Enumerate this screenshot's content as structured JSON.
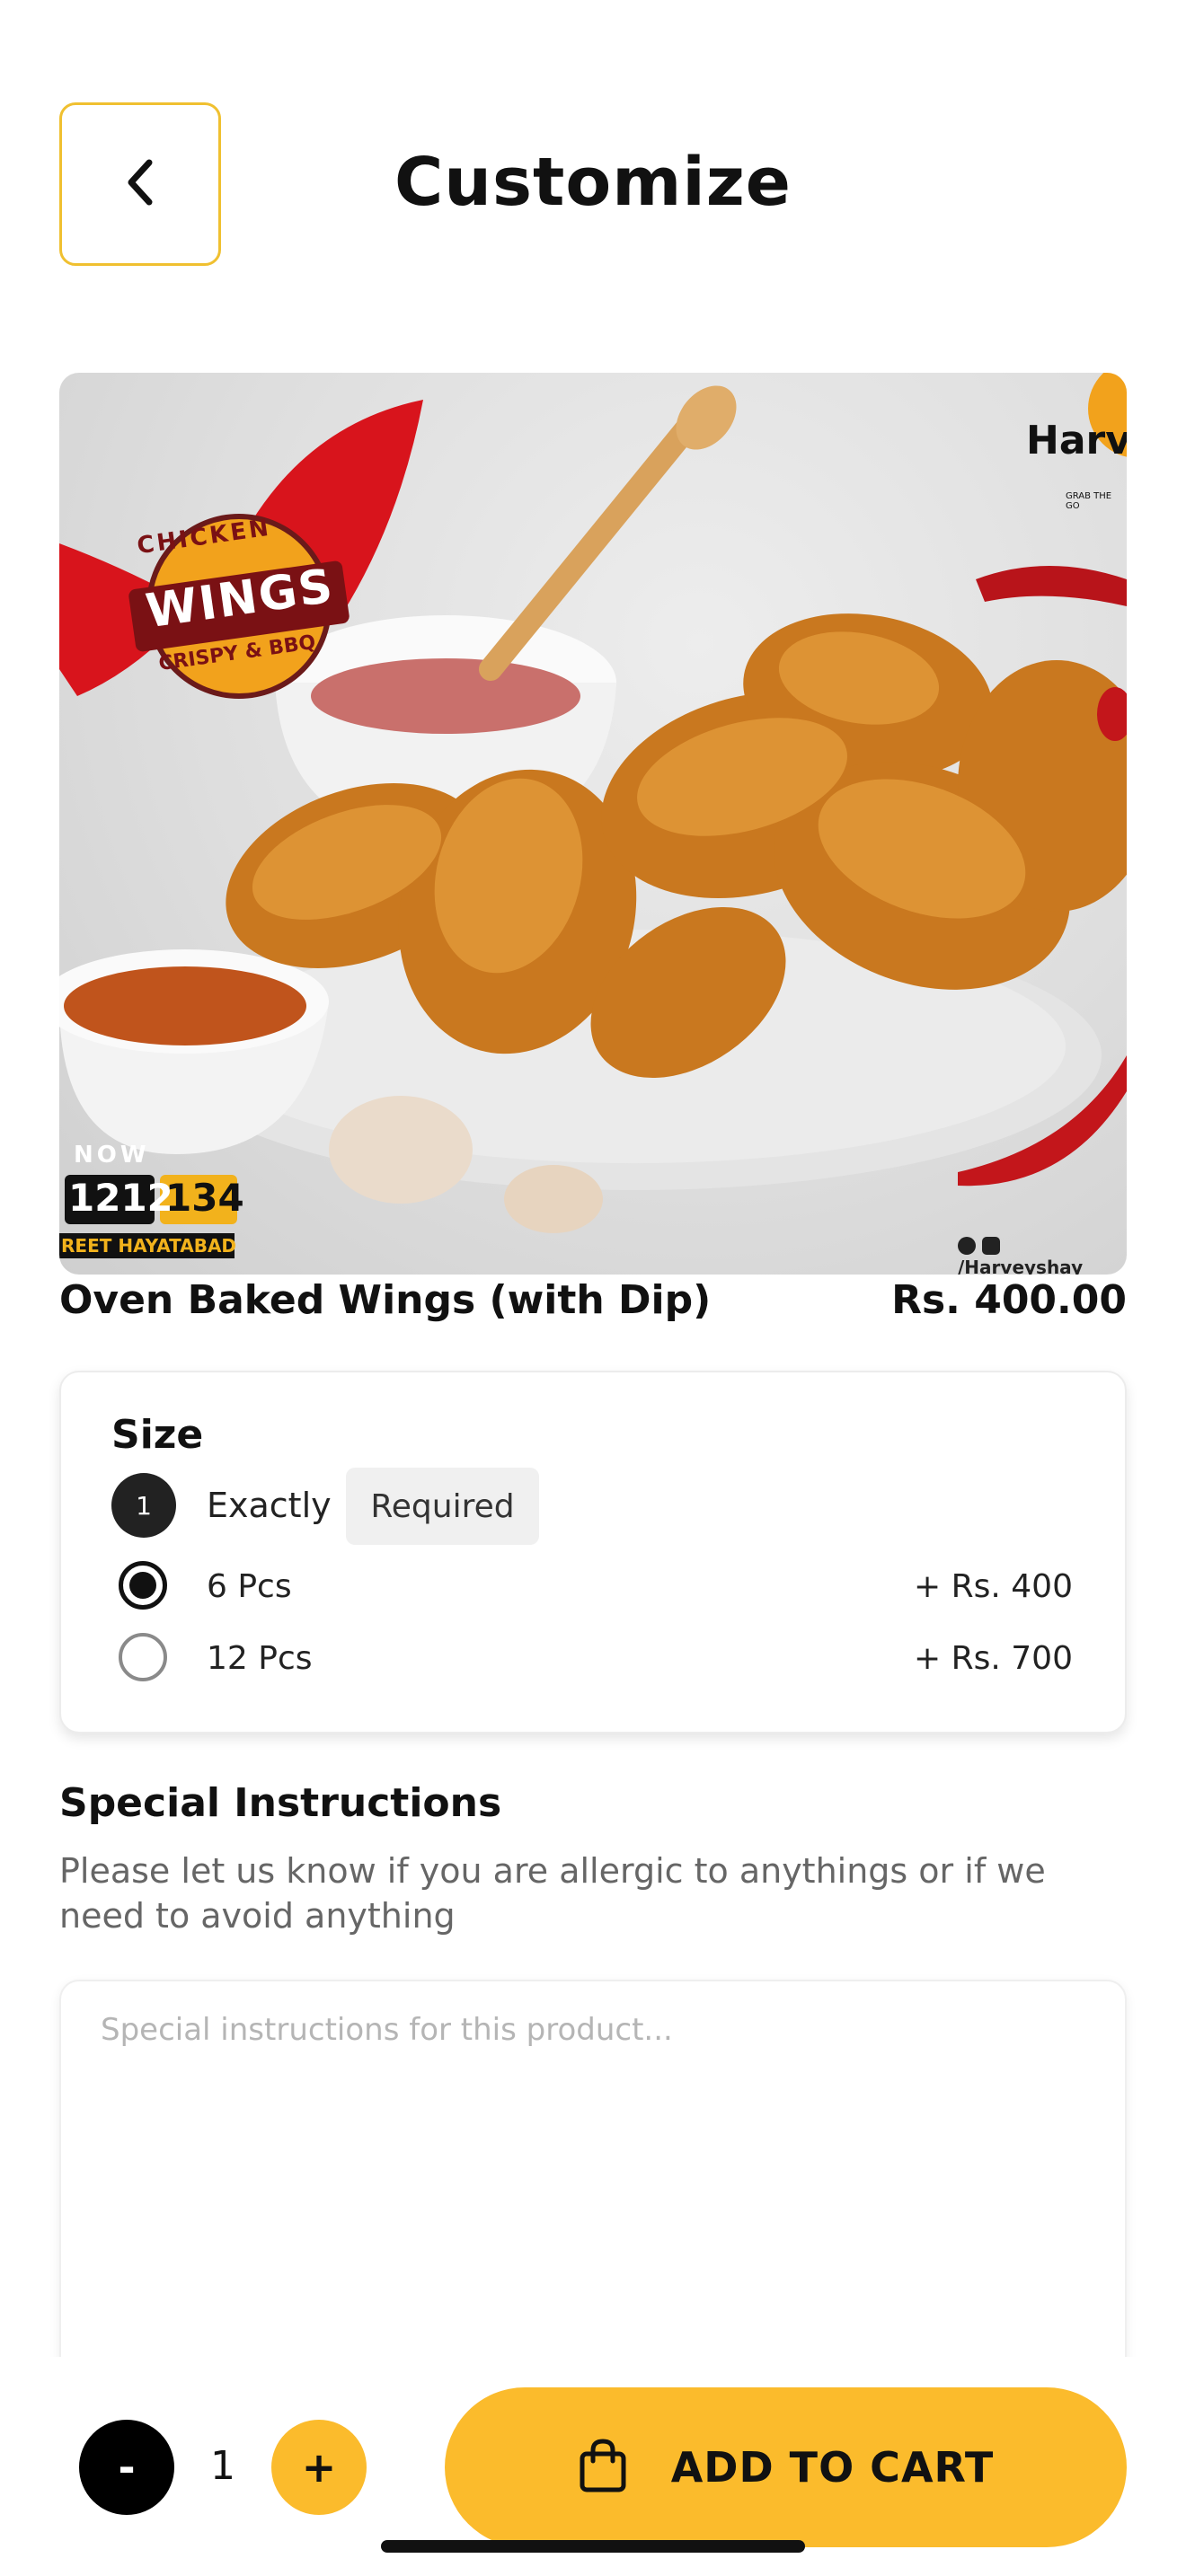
{
  "header": {
    "title": "Customize",
    "back_icon": "chevron-left-icon"
  },
  "hero": {
    "logo_top": "CHICKEN",
    "logo_main": "WINGS",
    "logo_bottom": "CRISPY & BBQ",
    "brand": "Harv",
    "brand_tagline": "GRAB THE GO",
    "order_now": "NOW",
    "phone_a": "1212",
    "phone_b": "134",
    "street": "REET HAYATABAD",
    "social": "/Harveyshay"
  },
  "product": {
    "name": "Oven Baked Wings (with Dip)",
    "price": "Rs. 400.00"
  },
  "size": {
    "title": "Size",
    "count": "1",
    "exactly_label": "Exactly",
    "required_label": "Required",
    "options": [
      {
        "label": "6 Pcs",
        "price": "+ Rs. 400",
        "selected": true
      },
      {
        "label": "12 Pcs",
        "price": "+ Rs. 700",
        "selected": false
      }
    ]
  },
  "instructions": {
    "title": "Special Instructions",
    "description": "Please let us know if you are allergic to anythings or if we need to avoid anything",
    "placeholder": "Special instructions for this product...",
    "value": ""
  },
  "cart": {
    "minus_label": "-",
    "quantity": "1",
    "plus_label": "+",
    "add_label": "ADD TO CART",
    "bag_icon": "shopping-bag-icon"
  },
  "colors": {
    "accent": "#fbbb2c",
    "back_border": "#f0c030",
    "dark": "#111111"
  }
}
